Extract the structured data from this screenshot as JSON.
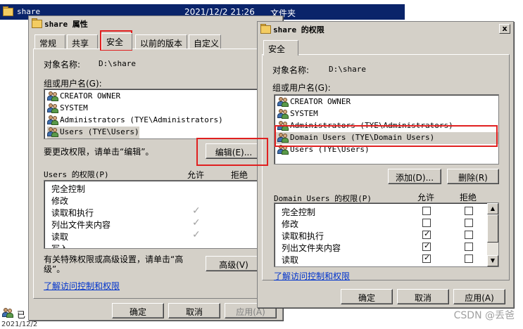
{
  "explorer": {
    "row_name": "share",
    "row_date": "2021/12/2 21:26",
    "row_type": "文件夹",
    "status_label": "已",
    "status_date": "2021/12/2 21:26"
  },
  "properties": {
    "title": "share 属性",
    "tabs": [
      "常规",
      "共享",
      "安全",
      "以前的版本",
      "自定义"
    ],
    "active_tab": "安全",
    "object_label": "对象名称:",
    "object_value": "D:\\share",
    "groups_label": "组或用户名(G):",
    "users": [
      "CREATOR OWNER",
      "SYSTEM",
      "Administrators (TYE\\Administrators)",
      "Users (TYE\\Users)"
    ],
    "edit_hint": "要更改权限，请单击“编辑”。",
    "edit_button": "编辑(E)...",
    "perm_header": "Users 的权限(P)",
    "allow_label": "允许",
    "deny_label": "拒绝",
    "permissions": [
      "完全控制",
      "修改",
      "读取和执行",
      "列出文件夹内容",
      "读取",
      "写入"
    ],
    "allowed": [
      false,
      false,
      true,
      true,
      true,
      false
    ],
    "special_hint": "有关特殊权限或高级设置，请单击“高级”。",
    "advanced_button": "高级(V)",
    "learn_link": "了解访问控制和权限",
    "ok_button": "确定",
    "cancel_button": "取消",
    "apply_button": "应用(A)"
  },
  "permissions_dialog": {
    "title": "share 的权限",
    "close_glyph": "x",
    "tab": "安全",
    "object_label": "对象名称:",
    "object_value": "D:\\share",
    "groups_label": "组或用户名(G):",
    "users": [
      "CREATOR OWNER",
      "SYSTEM",
      "Administrators (TYE\\Administrators)",
      "Domain Users (TYE\\Domain Users)",
      "Users (TYE\\Users)"
    ],
    "selected_user_index": 3,
    "add_button": "添加(D)...",
    "remove_button": "删除(R)",
    "perm_header": "Domain Users 的权限(P)",
    "allow_label": "允许",
    "deny_label": "拒绝",
    "permissions": [
      "完全控制",
      "修改",
      "读取和执行",
      "列出文件夹内容",
      "读取"
    ],
    "allow_checked": [
      false,
      false,
      true,
      true,
      true
    ],
    "deny_checked": [
      false,
      false,
      false,
      false,
      false
    ],
    "learn_link": "了解访问控制和权限",
    "ok_button": "确定",
    "cancel_button": "取消",
    "apply_button": "应用(A)"
  },
  "watermark": "CSDN @丢爸"
}
